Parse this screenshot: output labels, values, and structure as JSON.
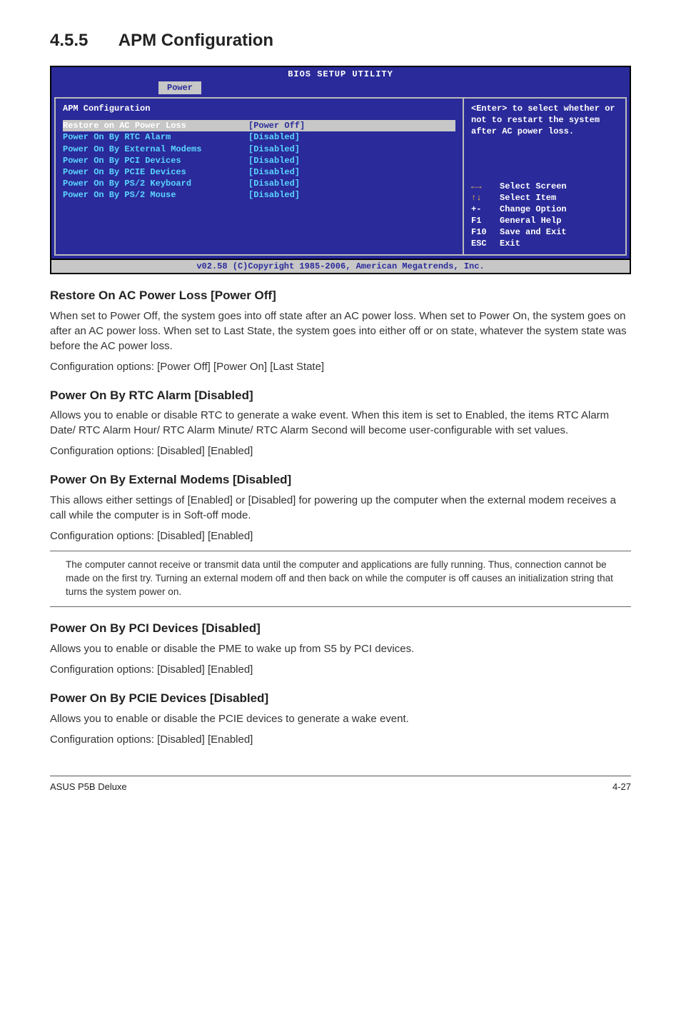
{
  "section": {
    "number": "4.5.5",
    "title": "APM Configuration"
  },
  "bios": {
    "title": "BIOS SETUP UTILITY",
    "tab": "Power",
    "header": "APM Configuration",
    "rows": [
      {
        "label": "Restore on AC Power Loss",
        "value": "[Power Off]",
        "selected": true
      },
      {
        "label": "Power On By RTC Alarm",
        "value": "[Disabled]",
        "selected": false
      },
      {
        "label": "Power On By External Modems",
        "value": "[Disabled]",
        "selected": false
      },
      {
        "label": "Power On By PCI Devices",
        "value": "[Disabled]",
        "selected": false
      },
      {
        "label": "Power On By PCIE Devices",
        "value": "[Disabled]",
        "selected": false
      },
      {
        "label": "Power On By PS/2 Keyboard",
        "value": "[Disabled]",
        "selected": false
      },
      {
        "label": "Power On By PS/2 Mouse",
        "value": "[Disabled]",
        "selected": false
      }
    ],
    "help": "<Enter> to select whether or not to restart the system after AC power loss.",
    "keys": [
      {
        "key": "←→",
        "action": "Select Screen",
        "arrow": true
      },
      {
        "key": "↑↓",
        "action": "Select Item",
        "arrow": true
      },
      {
        "key": "+-",
        "action": "Change Option",
        "arrow": false
      },
      {
        "key": "F1",
        "action": "General Help",
        "arrow": false
      },
      {
        "key": "F10",
        "action": "Save and Exit",
        "arrow": false
      },
      {
        "key": "ESC",
        "action": "Exit",
        "arrow": false
      }
    ],
    "footer": "v02.58 (C)Copyright 1985-2006, American Megatrends, Inc."
  },
  "subsections": {
    "restore": {
      "heading": "Restore On AC Power Loss [Power Off]",
      "body1": "When set to Power Off, the system goes into off state after an AC power loss. When set to Power On, the system goes on after an AC power loss. When set to Last State, the system goes into either off or on state, whatever the system state was before the AC power loss.",
      "body2": "Configuration options: [Power Off] [Power On] [Last State]"
    },
    "rtc": {
      "heading": "Power On By RTC Alarm [Disabled]",
      "body1": "Allows you to enable or disable RTC to generate a wake event. When this item is set to Enabled, the items RTC Alarm Date/ RTC Alarm Hour/ RTC Alarm Minute/ RTC Alarm Second will become user-configurable with set values.",
      "body2": "Configuration options: [Disabled] [Enabled]"
    },
    "modem": {
      "heading": "Power On By External Modems [Disabled]",
      "body1": "This allows either settings of [Enabled] or [Disabled] for powering up the computer when the external modem receives a call while the computer is in Soft-off mode.",
      "body2": "Configuration options: [Disabled] [Enabled]"
    },
    "note": {
      "text": "The computer cannot receive or transmit data until the computer and applications are fully running. Thus, connection cannot be made on the first try. Turning an external modem off and then back on while the computer is off causes an initialization string that turns the system power on."
    },
    "pci": {
      "heading": "Power On By PCI Devices [Disabled]",
      "body1": "Allows you to enable or disable the PME to wake up from S5 by PCI devices.",
      "body2": "Configuration options: [Disabled] [Enabled]"
    },
    "pcie": {
      "heading": "Power On By PCIE Devices [Disabled]",
      "body1": "Allows you to enable or disable the PCIE devices to generate a wake event.",
      "body2": "Configuration options: [Disabled] [Enabled]"
    }
  },
  "footer": {
    "left": "ASUS P5B Deluxe",
    "right": "4-27"
  }
}
